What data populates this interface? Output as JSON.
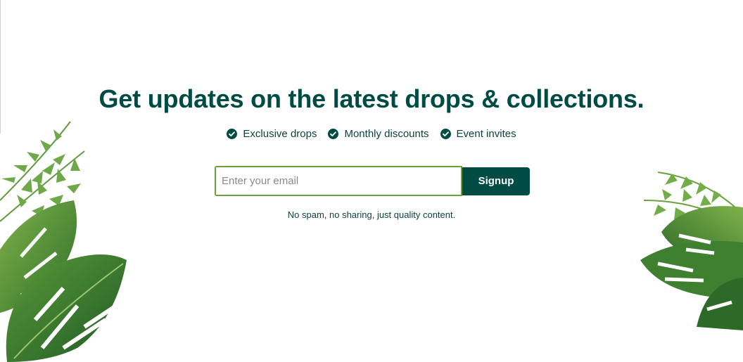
{
  "newsletter": {
    "headline": "Get updates on the latest drops & collections.",
    "benefits": [
      {
        "label": "Exclusive drops"
      },
      {
        "label": "Monthly discounts"
      },
      {
        "label": "Event invites"
      }
    ],
    "email_placeholder": "Enter your email",
    "email_value": "",
    "signup_label": "Signup",
    "disclaimer": "No spam, no sharing, just quality content."
  },
  "colors": {
    "brand": "#004b44",
    "input_border": "#6aa23a",
    "text": "#0c3f3b"
  },
  "icons": {
    "benefit_icon": "check-circle-icon",
    "decor_left": "tropical-leaves-illustration",
    "decor_right": "tropical-leaves-illustration"
  }
}
